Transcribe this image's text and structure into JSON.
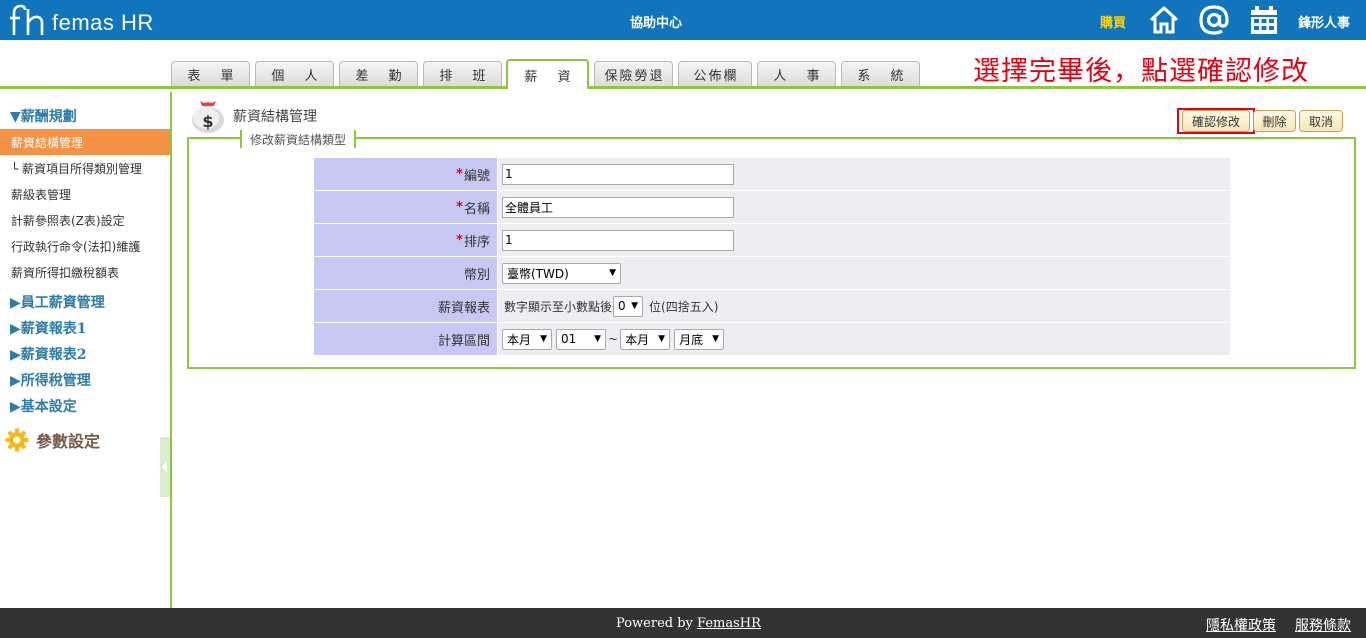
{
  "header": {
    "logo_text": "femas HR",
    "help_center": "協助中心",
    "buy": "購買",
    "icons": [
      "home-icon",
      "at-icon",
      "calendar-icon"
    ],
    "company": "鋒形人事"
  },
  "tabs": [
    {
      "label": "表 單",
      "active": false
    },
    {
      "label": "個 人",
      "active": false
    },
    {
      "label": "差 勤",
      "active": false
    },
    {
      "label": "排 班",
      "active": false
    },
    {
      "label": "薪 資",
      "active": true
    },
    {
      "label": "保險勞退",
      "active": false
    },
    {
      "label": "公佈欄",
      "active": false
    },
    {
      "label": "人 事",
      "active": false
    },
    {
      "label": "系 統",
      "active": false
    }
  ],
  "instruction": "選擇完畢後，點選確認修改",
  "sidebar": {
    "sections": [
      {
        "title": "▼薪酬規劃",
        "expanded": true
      },
      {
        "title": "▶員工薪資管理",
        "expanded": false
      },
      {
        "title": "▶薪資報表1",
        "expanded": false
      },
      {
        "title": "▶薪資報表2",
        "expanded": false
      },
      {
        "title": "▶所得稅管理",
        "expanded": false
      },
      {
        "title": "▶基本設定",
        "expanded": false
      }
    ],
    "items": [
      {
        "label": "薪資結構管理",
        "active": true
      },
      {
        "label": "└ 薪資項目所得類別管理",
        "active": false
      },
      {
        "label": "薪級表管理",
        "active": false
      },
      {
        "label": "計薪參照表(Z表)設定",
        "active": false
      },
      {
        "label": "行政執行命令(法扣)維護",
        "active": false
      },
      {
        "label": "薪資所得扣繳稅額表",
        "active": false
      }
    ],
    "params": "參數設定"
  },
  "page": {
    "title": "薪資結構管理",
    "legend": "修改薪資結構類型",
    "buttons": {
      "confirm": "確認修改",
      "delete": "刪除",
      "cancel": "取消"
    }
  },
  "form": {
    "req_mark": "*",
    "id": {
      "label": "編號",
      "value": "1"
    },
    "name": {
      "label": "名稱",
      "value": "全體員工"
    },
    "order": {
      "label": "排序",
      "value": "1"
    },
    "currency": {
      "label": "幣別",
      "value": "臺幣(TWD)"
    },
    "report": {
      "label": "薪資報表",
      "prefix": "數字顯示至小數點後",
      "decimals": "0",
      "suffix": "位(四捨五入)"
    },
    "period": {
      "label": "計算區間",
      "start_month": "本月",
      "start_day": "01",
      "separator": "~",
      "end_month": "本月",
      "end_day": "月底"
    }
  },
  "footer": {
    "powered_prefix": "Powered by ",
    "powered_link": "FemasHR",
    "privacy": "隱私權政策",
    "terms": "服務條款"
  },
  "colors": {
    "header_blue": "#1075bd",
    "accent_green": "#8dc63f",
    "active_orange": "#f39245",
    "label_lavender": "#c8c8f5",
    "instruction_red": "#e60012"
  }
}
